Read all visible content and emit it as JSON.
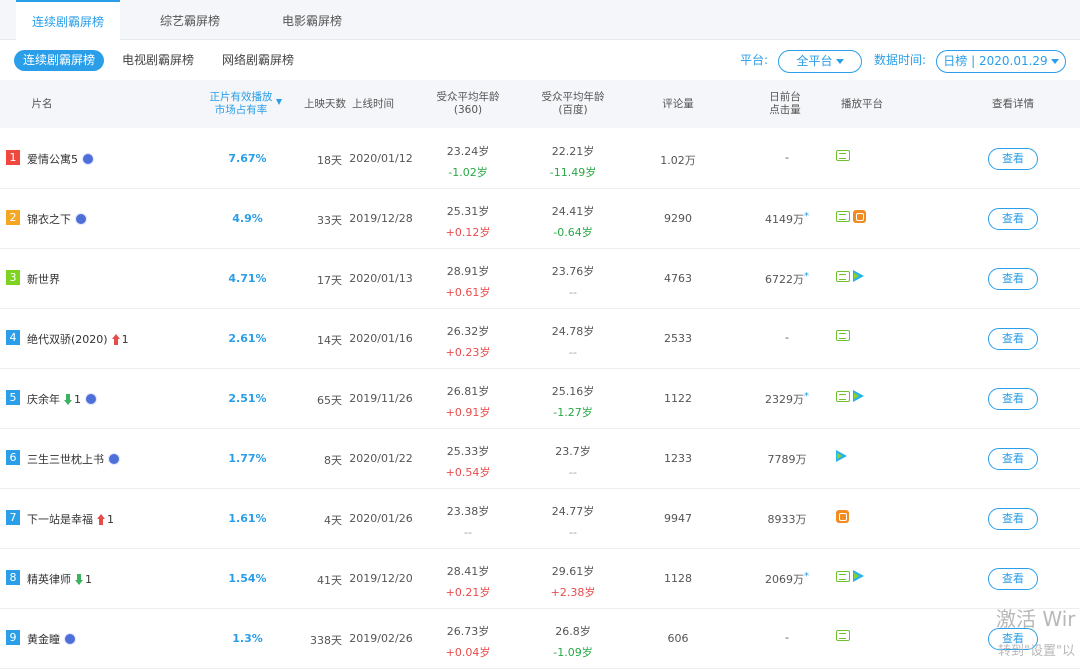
{
  "top_tabs": [
    {
      "label": "连续剧霸屏榜",
      "active": true
    },
    {
      "label": "综艺霸屏榜",
      "active": false
    },
    {
      "label": "电影霸屏榜",
      "active": false
    }
  ],
  "sub_tabs": [
    {
      "label": "连续剧霸屏榜",
      "active": true
    },
    {
      "label": "电视剧霸屏榜",
      "active": false
    },
    {
      "label": "网络剧霸屏榜",
      "active": false
    }
  ],
  "filters": {
    "platform_label": "平台:",
    "platform_value": "全平台",
    "date_label": "数据时间:",
    "date_value": "日榜 | 2020.01.29"
  },
  "columns": {
    "name": "片名",
    "share_line1": "正片有效播放",
    "share_line2": "市场占有率",
    "days": "上映天数",
    "release": "上线时间",
    "age360_line1": "受众平均年龄",
    "age360_line2": "(360)",
    "agebaidu_line1": "受众平均年龄",
    "agebaidu_line2": "(百度)",
    "comments": "评论量",
    "clicks_line1": "日前台",
    "clicks_line2": "点击量",
    "platforms": "播放平台",
    "details": "查看详情"
  },
  "colors": {
    "accent": "#2a9ee8",
    "rank_1": "#f0483e",
    "rank_2": "#f5a623",
    "rank_3": "#7ed321",
    "rank_other": "#2a9ee8",
    "positive": "#e74c4c",
    "negative": "#27a844"
  },
  "rows": [
    {
      "rank": "1",
      "title": "爱情公寓5",
      "bubble": true,
      "trend": "",
      "trend_num": "",
      "share": "7.67%",
      "days": "18天",
      "date": "2020/01/12",
      "age360": "23.24岁",
      "age360_delta": "-1.02岁",
      "age360_dir": "neg",
      "agebaidu": "22.21岁",
      "agebaidu_delta": "-11.49岁",
      "agebaidu_dir": "neg",
      "comments": "1.02万",
      "clicks": "-",
      "clicks_star": false,
      "platforms": [
        "iqiyi-icon"
      ],
      "button": "查看"
    },
    {
      "rank": "2",
      "title": "锦衣之下",
      "bubble": true,
      "trend": "",
      "trend_num": "",
      "share": "4.9%",
      "days": "33天",
      "date": "2019/12/28",
      "age360": "25.31岁",
      "age360_delta": "+0.12岁",
      "age360_dir": "pos",
      "agebaidu": "24.41岁",
      "agebaidu_delta": "-0.64岁",
      "agebaidu_dir": "neg",
      "comments": "9290",
      "clicks": "4149万",
      "clicks_star": true,
      "platforms": [
        "iqiyi-icon",
        "youku-icon"
      ],
      "button": "查看"
    },
    {
      "rank": "3",
      "title": "新世界",
      "bubble": false,
      "trend": "",
      "trend_num": "",
      "share": "4.71%",
      "days": "17天",
      "date": "2020/01/13",
      "age360": "28.91岁",
      "age360_delta": "+0.61岁",
      "age360_dir": "pos",
      "agebaidu": "23.76岁",
      "agebaidu_delta": "--",
      "agebaidu_dir": "na",
      "comments": "4763",
      "clicks": "6722万",
      "clicks_star": true,
      "platforms": [
        "iqiyi-icon",
        "tencent-video-icon"
      ],
      "button": "查看"
    },
    {
      "rank": "4",
      "title": "绝代双骄(2020)",
      "bubble": false,
      "trend": "up",
      "trend_num": "1",
      "share": "2.61%",
      "days": "14天",
      "date": "2020/01/16",
      "age360": "26.32岁",
      "age360_delta": "+0.23岁",
      "age360_dir": "pos",
      "agebaidu": "24.78岁",
      "agebaidu_delta": "--",
      "agebaidu_dir": "na",
      "comments": "2533",
      "clicks": "-",
      "clicks_star": false,
      "platforms": [
        "iqiyi-icon"
      ],
      "button": "查看"
    },
    {
      "rank": "5",
      "title": "庆余年",
      "bubble": true,
      "trend": "down",
      "trend_num": "1",
      "share": "2.51%",
      "days": "65天",
      "date": "2019/11/26",
      "age360": "26.81岁",
      "age360_delta": "+0.91岁",
      "age360_dir": "pos",
      "agebaidu": "25.16岁",
      "agebaidu_delta": "-1.27岁",
      "agebaidu_dir": "neg",
      "comments": "1122",
      "clicks": "2329万",
      "clicks_star": true,
      "platforms": [
        "iqiyi-icon",
        "tencent-video-icon"
      ],
      "button": "查看"
    },
    {
      "rank": "6",
      "title": "三生三世枕上书",
      "bubble": true,
      "trend": "",
      "trend_num": "",
      "share": "1.77%",
      "days": "8天",
      "date": "2020/01/22",
      "age360": "25.33岁",
      "age360_delta": "+0.54岁",
      "age360_dir": "pos",
      "agebaidu": "23.7岁",
      "agebaidu_delta": "--",
      "agebaidu_dir": "na",
      "comments": "1233",
      "clicks": "7789万",
      "clicks_star": false,
      "platforms": [
        "tencent-video-icon"
      ],
      "button": "查看"
    },
    {
      "rank": "7",
      "title": "下一站是幸福",
      "bubble": false,
      "trend": "up",
      "trend_num": "1",
      "share": "1.61%",
      "days": "4天",
      "date": "2020/01/26",
      "age360": "23.38岁",
      "age360_delta": "--",
      "age360_dir": "na",
      "agebaidu": "24.77岁",
      "agebaidu_delta": "--",
      "agebaidu_dir": "na",
      "comments": "9947",
      "clicks": "8933万",
      "clicks_star": false,
      "platforms": [
        "youku-icon"
      ],
      "button": "查看"
    },
    {
      "rank": "8",
      "title": "精英律师",
      "bubble": false,
      "trend": "down",
      "trend_num": "1",
      "share": "1.54%",
      "days": "41天",
      "date": "2019/12/20",
      "age360": "28.41岁",
      "age360_delta": "+0.21岁",
      "age360_dir": "pos",
      "agebaidu": "29.61岁",
      "agebaidu_delta": "+2.38岁",
      "agebaidu_dir": "pos",
      "comments": "1128",
      "clicks": "2069万",
      "clicks_star": true,
      "platforms": [
        "iqiyi-icon",
        "tencent-video-icon"
      ],
      "button": "查看"
    },
    {
      "rank": "9",
      "title": "黄金瞳",
      "bubble": true,
      "trend": "",
      "trend_num": "",
      "share": "1.3%",
      "days": "338天",
      "date": "2019/02/26",
      "age360": "26.73岁",
      "age360_delta": "+0.04岁",
      "age360_dir": "pos",
      "agebaidu": "26.8岁",
      "agebaidu_delta": "-1.09岁",
      "agebaidu_dir": "neg",
      "comments": "606",
      "clicks": "-",
      "clicks_star": false,
      "platforms": [
        "iqiyi-icon"
      ],
      "button": "查看"
    }
  ],
  "watermark": {
    "line1": "激活 Wir",
    "line2": "转到\"设置\"以"
  }
}
